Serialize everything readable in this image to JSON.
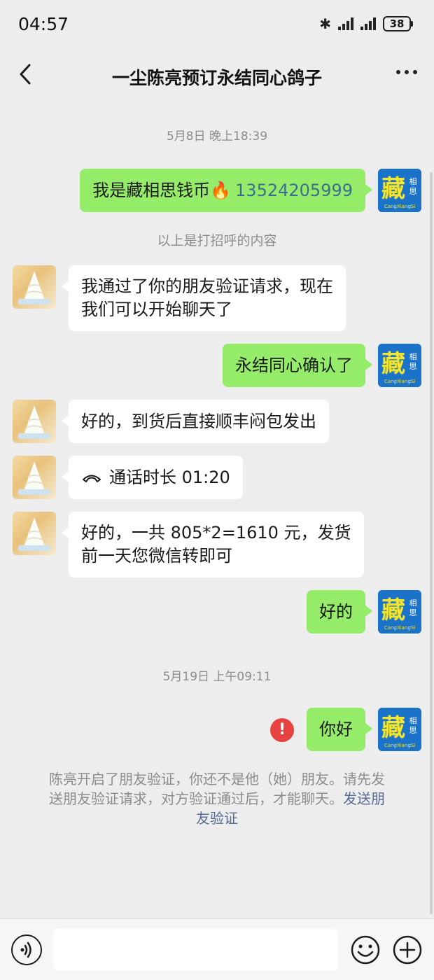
{
  "status_bar": {
    "time": "04:57",
    "battery": "38"
  },
  "header": {
    "title": "一尘陈亮预订永结同心鸽子"
  },
  "timestamps": [
    "5月8日 晚上18:39",
    "5月19日 上午09:11"
  ],
  "system_note": "以上是打招呼的内容",
  "messages": [
    {
      "from": "me",
      "text": "我是藏相思钱币🔥",
      "phone": "13524205999"
    },
    {
      "from": "other",
      "lines": [
        "我通过了你的朋友验证请求，现在",
        "我们可以开始聊天了"
      ]
    },
    {
      "from": "me",
      "text": "永结同心确认了"
    },
    {
      "from": "other",
      "text": "好的，到货后直接顺丰闷包发出"
    },
    {
      "from": "other",
      "call_icon": "phone-hangup-icon",
      "text": "通话时长 01:20"
    },
    {
      "from": "other",
      "lines": [
        "好的，一共 805*2=1610 元，发货",
        "前一天您微信转即可"
      ]
    },
    {
      "from": "me",
      "text": "好的"
    },
    {
      "from": "me",
      "text": "你好",
      "failed": true,
      "failed_mark": "!"
    }
  ],
  "friend_notice": {
    "lines": [
      "陈亮开启了朋友验证，你还不是他（她）朋友。请先发",
      "送朋友验证请求，对方验证通过后，才能聊天。"
    ],
    "link_inline": "发送朋",
    "link_tail": "友验证"
  },
  "avatar_me": {
    "big_char": "藏",
    "side_chars": [
      "相",
      "思"
    ],
    "sub_text": "CangXiangSi",
    "colors": {
      "bg": "#1a73c9",
      "text": "#f5e52a"
    }
  },
  "colors": {
    "bubble_me": "#95ec69",
    "bubble_other": "#ffffff",
    "background": "#ededed",
    "error": "#e64340",
    "link": "#576b95"
  },
  "icons": {
    "back": "chevron-left-icon",
    "more": "more-dots-icon",
    "voice": "voice-icon",
    "emoji": "emoji-icon",
    "plus": "plus-icon",
    "bluetooth": "bluetooth-icon",
    "signal": "signal-icon",
    "battery": "battery-icon"
  }
}
